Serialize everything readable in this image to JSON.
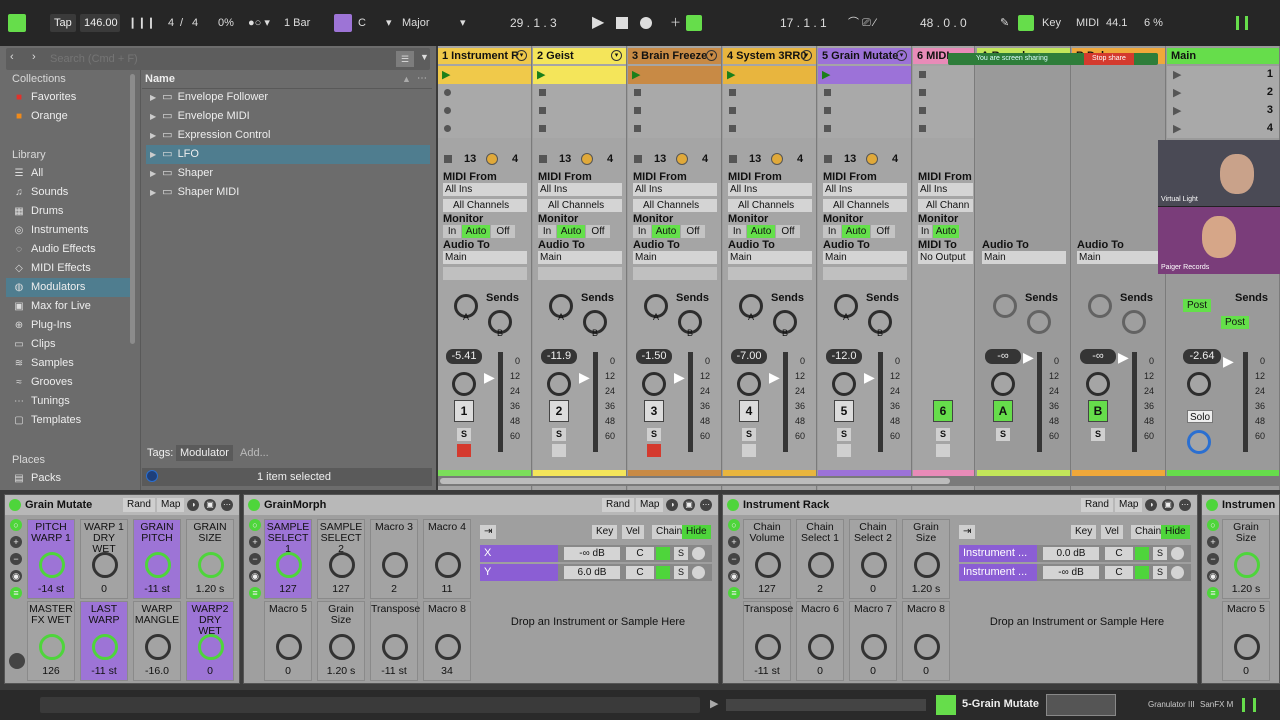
{
  "transport": {
    "tap": "Tap",
    "tempo": "146.00",
    "time_sig_num": "4",
    "time_sig_den": "4",
    "swing": "0%",
    "quantize": "1 Bar",
    "key": "C",
    "scale": "Major",
    "position": "29 . 1 . 3",
    "loop_start": "17 . 1 . 1",
    "loop_length": "48 . 0 . 0",
    "key_label": "Key",
    "midi_label": "MIDI",
    "sample_rate": "44.1",
    "cpu": "6 %"
  },
  "browser": {
    "search_placeholder": "Search (Cmd + F)",
    "collections_title": "Collections",
    "collections": [
      {
        "label": "Favorites",
        "color": "#e0322b"
      },
      {
        "label": "Orange",
        "color": "#f08a1a"
      }
    ],
    "library_title": "Library",
    "library": [
      "All",
      "Sounds",
      "Drums",
      "Instruments",
      "Audio Effects",
      "MIDI Effects",
      "Modulators",
      "Max for Live",
      "Plug-Ins",
      "Clips",
      "Samples",
      "Grooves",
      "Tunings",
      "Templates"
    ],
    "places_title": "Places",
    "places": [
      "Packs"
    ],
    "name_header": "Name",
    "items": [
      "Envelope Follower",
      "Envelope MIDI",
      "Expression Control",
      "LFO",
      "Shaper",
      "Shaper MIDI"
    ],
    "tags_label": "Tags:",
    "tag": "Modulator",
    "tag_add": "Add...",
    "status": "1 item selected"
  },
  "tracks": [
    {
      "name": "1 Instrument R",
      "color": "#f0c94a",
      "n1": "13",
      "n2": "4",
      "in_from": "All Ins",
      "chan": "All Channels",
      "out": "Main",
      "vol": "-5.41",
      "num": "1",
      "bar": "#7bde5a"
    },
    {
      "name": "2 Geist",
      "color": "#f4e55a",
      "n1": "13",
      "n2": "4",
      "in_from": "All Ins",
      "chan": "All Channels",
      "out": "Main",
      "vol": "-11.9",
      "num": "2",
      "bar": "#f4e55a"
    },
    {
      "name": "3 Brain Freeze",
      "color": "#c88a45",
      "n1": "13",
      "n2": "4",
      "in_from": "All Ins",
      "chan": "All Channels",
      "out": "Main",
      "vol": "-1.50",
      "num": "3",
      "bar": "#c88a45"
    },
    {
      "name": "4 System 3RR0",
      "color": "#e8b53e",
      "n1": "13",
      "n2": "4",
      "in_from": "All Ins",
      "chan": "All Channels",
      "out": "Main",
      "vol": "-7.00",
      "num": "4",
      "bar": "#e8b53e"
    },
    {
      "name": "5 Grain Mutate",
      "color": "#9c72d8",
      "n1": "13",
      "n2": "4",
      "in_from": "All Ins",
      "chan": "All Channels",
      "out": "Main",
      "vol": "-12.0",
      "num": "5",
      "bar": "#9c72d8"
    }
  ],
  "track6": {
    "name": "6 MIDI",
    "in_from": "All Ins",
    "chan": "All Chann",
    "out_label": "MIDI To",
    "out": "No Output",
    "num": "6"
  },
  "returns": [
    {
      "name": "A Reverb",
      "out": "Main",
      "vol": "-∞",
      "num": "A"
    },
    {
      "name": "B Delay",
      "out": "Main",
      "vol": "-∞",
      "num": "B"
    }
  ],
  "master": {
    "name": "Main",
    "vol": "-2.64",
    "scenes": [
      "1",
      "2",
      "3",
      "4"
    ],
    "post1": "Post",
    "post2": "Post",
    "solo": "Solo"
  },
  "labels": {
    "midi_from": "MIDI From",
    "monitor": "Monitor",
    "audio_to": "Audio To",
    "in": "In",
    "auto": "Auto",
    "off": "Off",
    "sends": "Sends",
    "s": "S",
    "a": "A",
    "b": "B"
  },
  "scale_ticks": [
    "0",
    "12",
    "24",
    "36",
    "48",
    "60"
  ],
  "sharing": {
    "text": "You are screen sharing",
    "stop": "Stop share"
  },
  "video": {
    "name1": "Virtual Light",
    "name2": "Paiger Records"
  },
  "devices": {
    "d1": {
      "title": "Grain Mutate",
      "rand": "Rand",
      "map": "Map",
      "macros": [
        {
          "n": "PITCH WARP 1",
          "v": "-14 st",
          "hl": true
        },
        {
          "n": "WARP 1 DRY WET",
          "v": "0",
          "hl": false
        },
        {
          "n": "GRAIN PITCH",
          "v": "-11 st",
          "hl": true
        },
        {
          "n": "GRAIN SIZE",
          "v": "1.20 s",
          "hl": false
        },
        {
          "n": "MASTER FX WET",
          "v": "126",
          "hl": false
        },
        {
          "n": "LAST WARP",
          "v": "-11 st",
          "hl": true
        },
        {
          "n": "WARP MANGLE",
          "v": "-16.0",
          "hl": false
        },
        {
          "n": "WARP2 DRY WET",
          "v": "0",
          "hl": true
        }
      ]
    },
    "d2": {
      "title": "GrainMorph",
      "rand": "Rand",
      "map": "Map",
      "macros": [
        {
          "n": "SAMPLE SELECT 1",
          "v": "127",
          "hl": true
        },
        {
          "n": "SAMPLE SELECT 2",
          "v": "127",
          "hl": false
        },
        {
          "n": "Macro 3",
          "v": "2",
          "hl": false
        },
        {
          "n": "Macro 4",
          "v": "11",
          "hl": false
        },
        {
          "n": "Macro 5",
          "v": "0",
          "hl": false
        },
        {
          "n": "Grain Size",
          "v": "1.20 s",
          "hl": false
        },
        {
          "n": "Transpose",
          "v": "-11 st",
          "hl": false
        },
        {
          "n": "Macro 8",
          "v": "34",
          "hl": false
        }
      ],
      "chains": [
        {
          "n": "X",
          "db": "-∞ dB",
          "c": "C"
        },
        {
          "n": "Y",
          "db": "6.0 dB",
          "c": "C"
        }
      ],
      "drop": "Drop an Instrument or Sample Here"
    },
    "d3": {
      "title": "Instrument Rack",
      "rand": "Rand",
      "map": "Map",
      "macros": [
        {
          "n": "Chain Volume",
          "v": "127",
          "hl": false
        },
        {
          "n": "Chain Select 1",
          "v": "2",
          "hl": false
        },
        {
          "n": "Chain Select 2",
          "v": "0",
          "hl": false
        },
        {
          "n": "Grain Size",
          "v": "1.20 s",
          "hl": false
        },
        {
          "n": "Transpose",
          "v": "-11 st",
          "hl": false
        },
        {
          "n": "Macro 6",
          "v": "0",
          "hl": false
        },
        {
          "n": "Macro 7",
          "v": "0",
          "hl": false
        },
        {
          "n": "Macro 8",
          "v": "0",
          "hl": false
        }
      ],
      "chains": [
        {
          "n": "Instrument ...",
          "db": "0.0 dB",
          "c": "C"
        },
        {
          "n": "Instrument ...",
          "db": "-∞ dB",
          "c": "C"
        }
      ],
      "drop": "Drop an Instrument or Sample Here"
    },
    "d4": {
      "title": "Instrumen",
      "macros": [
        {
          "n": "Grain Size",
          "v": "1.20 s"
        },
        {
          "n": "Macro 5",
          "v": "0"
        }
      ]
    },
    "tabs": {
      "key": "Key",
      "vel": "Vel",
      "chain": "Chain",
      "hide": "Hide"
    }
  },
  "status": {
    "clip": "5-Grain Mutate",
    "plugin1": "Granulator III",
    "plugin2": "SanFX M"
  }
}
